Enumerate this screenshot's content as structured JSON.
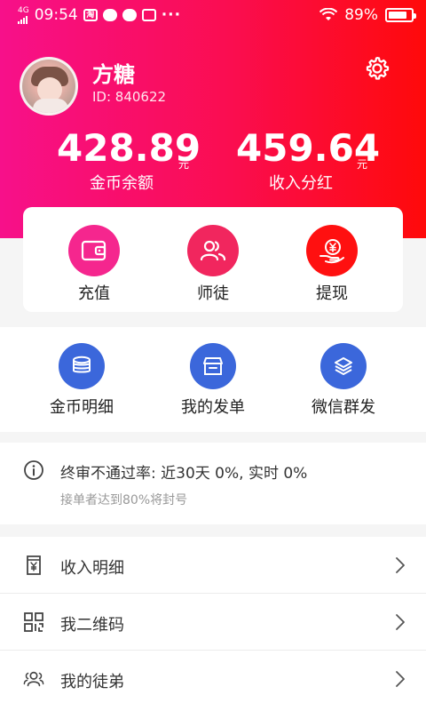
{
  "status_bar": {
    "network": "4G",
    "time": "09:54",
    "app_badge": "淘",
    "more": "···",
    "battery": "89%"
  },
  "profile": {
    "name": "方糖",
    "id_text": "ID: 840622"
  },
  "stats": [
    {
      "value": "428.89",
      "unit": "元",
      "label": "金币余额"
    },
    {
      "value": "459.64",
      "unit": "元",
      "label": "收入分红"
    }
  ],
  "quick_actions": [
    {
      "label": "充值",
      "icon": "wallet-icon",
      "color": "#f5268e"
    },
    {
      "label": "师徒",
      "icon": "users-icon",
      "color": "#f1265e"
    },
    {
      "label": "提现",
      "icon": "yuan-hand-icon",
      "color": "#ff1010"
    }
  ],
  "secondary_actions": [
    {
      "label": "金币明细",
      "icon": "coins-icon",
      "color": "#3b67db"
    },
    {
      "label": "我的发单",
      "icon": "store-icon",
      "color": "#3b67db"
    },
    {
      "label": "微信群发",
      "icon": "layers-icon",
      "color": "#3b67db"
    }
  ],
  "notice": {
    "text": "终审不通过率: 近30天 0%, 实时 0%",
    "sub": "接单者达到80%将封号"
  },
  "menu": [
    {
      "label": "收入明细",
      "icon": "receipt-icon"
    },
    {
      "label": "我二维码",
      "icon": "qrcode-icon"
    },
    {
      "label": "我的徒弟",
      "icon": "users-icon"
    }
  ]
}
